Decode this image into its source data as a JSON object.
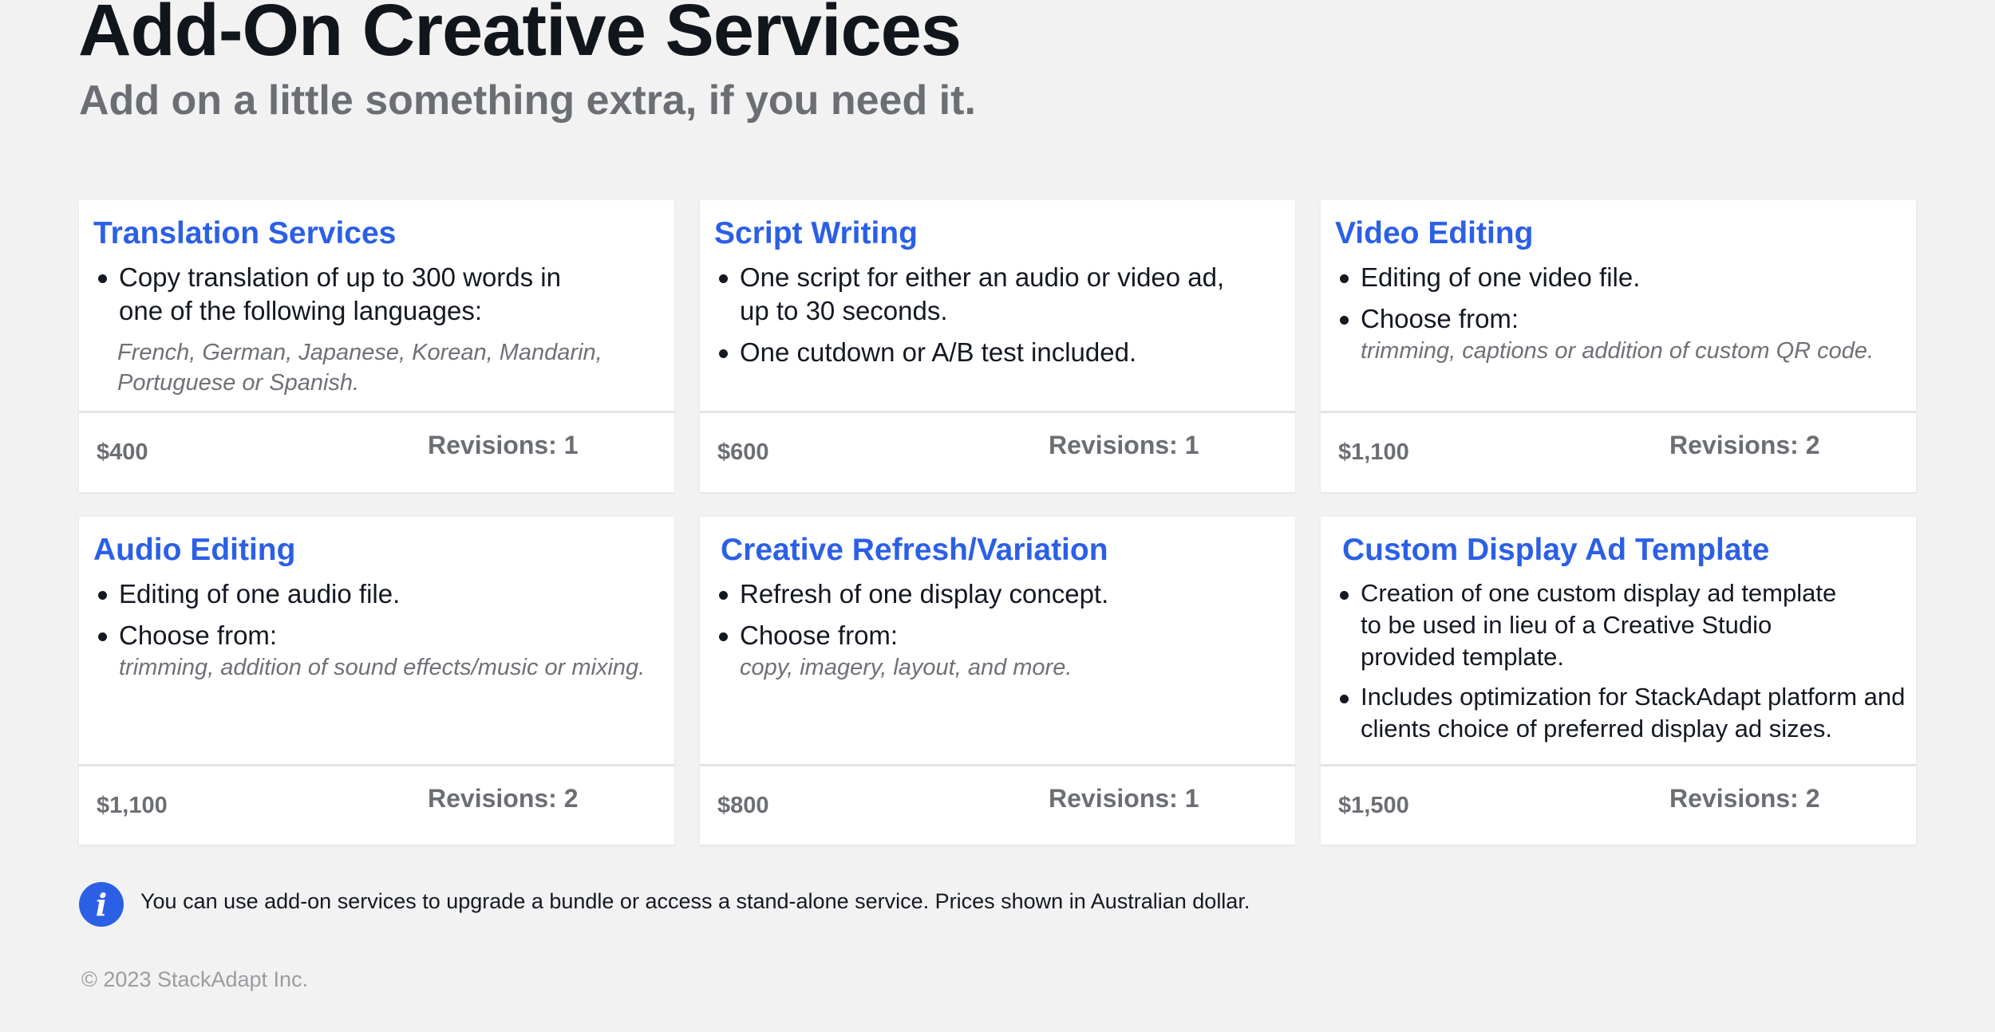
{
  "header": {
    "title": "Add-On Creative Services",
    "subtitle": "Add on a little something extra, if you need it."
  },
  "cards": [
    {
      "title": "Translation Services",
      "bullets": [
        {
          "text": "Copy translation of up to 300 words in one of the following languages:",
          "note": ""
        }
      ],
      "note": "French, German, Japanese, Korean, Mandarin, Portuguese or Spanish.",
      "price": "$400",
      "revisions": "Revisions: 1"
    },
    {
      "title": "Script Writing",
      "bullets": [
        {
          "text": "One script for either an audio or video ad, up to 30 seconds.",
          "note": ""
        },
        {
          "text": "One cutdown or A/B test included.",
          "note": ""
        }
      ],
      "note": "",
      "price": "$600",
      "revisions": "Revisions: 1"
    },
    {
      "title": "Video Editing",
      "bullets": [
        {
          "text": "Editing of one video file.",
          "note": ""
        },
        {
          "text": "Choose from:",
          "note": "trimming, captions or addition of custom QR code."
        }
      ],
      "note": "",
      "price": "$1,100",
      "revisions": "Revisions: 2"
    },
    {
      "title": "Audio Editing",
      "bullets": [
        {
          "text": "Editing of one audio file.",
          "note": ""
        },
        {
          "text": "Choose from:",
          "note": "trimming, addition of sound effects/music or mixing."
        }
      ],
      "note": "",
      "price": "$1,100",
      "revisions": "Revisions: 2"
    },
    {
      "title": "Creative Refresh/Variation",
      "bullets": [
        {
          "text": "Refresh of one display concept.",
          "note": ""
        },
        {
          "text": "Choose from:",
          "note": "copy, imagery, layout, and more."
        }
      ],
      "note": "",
      "price": "$800",
      "revisions": "Revisions: 1"
    },
    {
      "title": "Custom Display Ad Template",
      "bullets": [
        {
          "text": "Creation of one custom display ad template to be used in lieu of a Creative Studio provided template.",
          "note": ""
        },
        {
          "text": "Includes optimization for StackAdapt platform and clients choice of preferred display ad sizes.",
          "note": ""
        }
      ],
      "note": "",
      "price": "$1,500",
      "revisions": "Revisions: 2"
    }
  ],
  "footer": {
    "info_icon": "info-circle-icon",
    "note": "You can use add-on services to upgrade a bundle or access a stand-alone service. Prices shown in Australian dollar.",
    "copyright": "© 2023 StackAdapt Inc."
  }
}
